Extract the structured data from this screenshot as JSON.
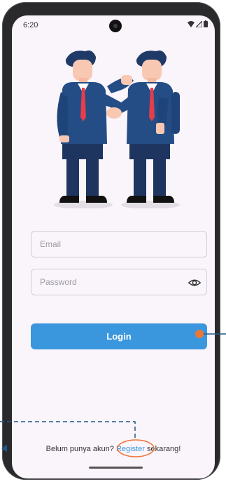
{
  "status": {
    "time": "6:20"
  },
  "login": {
    "email_placeholder": "Email",
    "password_placeholder": "Password",
    "login_label": "Login"
  },
  "register": {
    "prefix": "Belum punya akun? ",
    "link": "Register",
    "suffix": " sekarang!"
  },
  "colors": {
    "primary": "#3b97dd",
    "background": "#faf4fb",
    "annotation": "#1f5a86",
    "highlight": "#ef7536"
  }
}
